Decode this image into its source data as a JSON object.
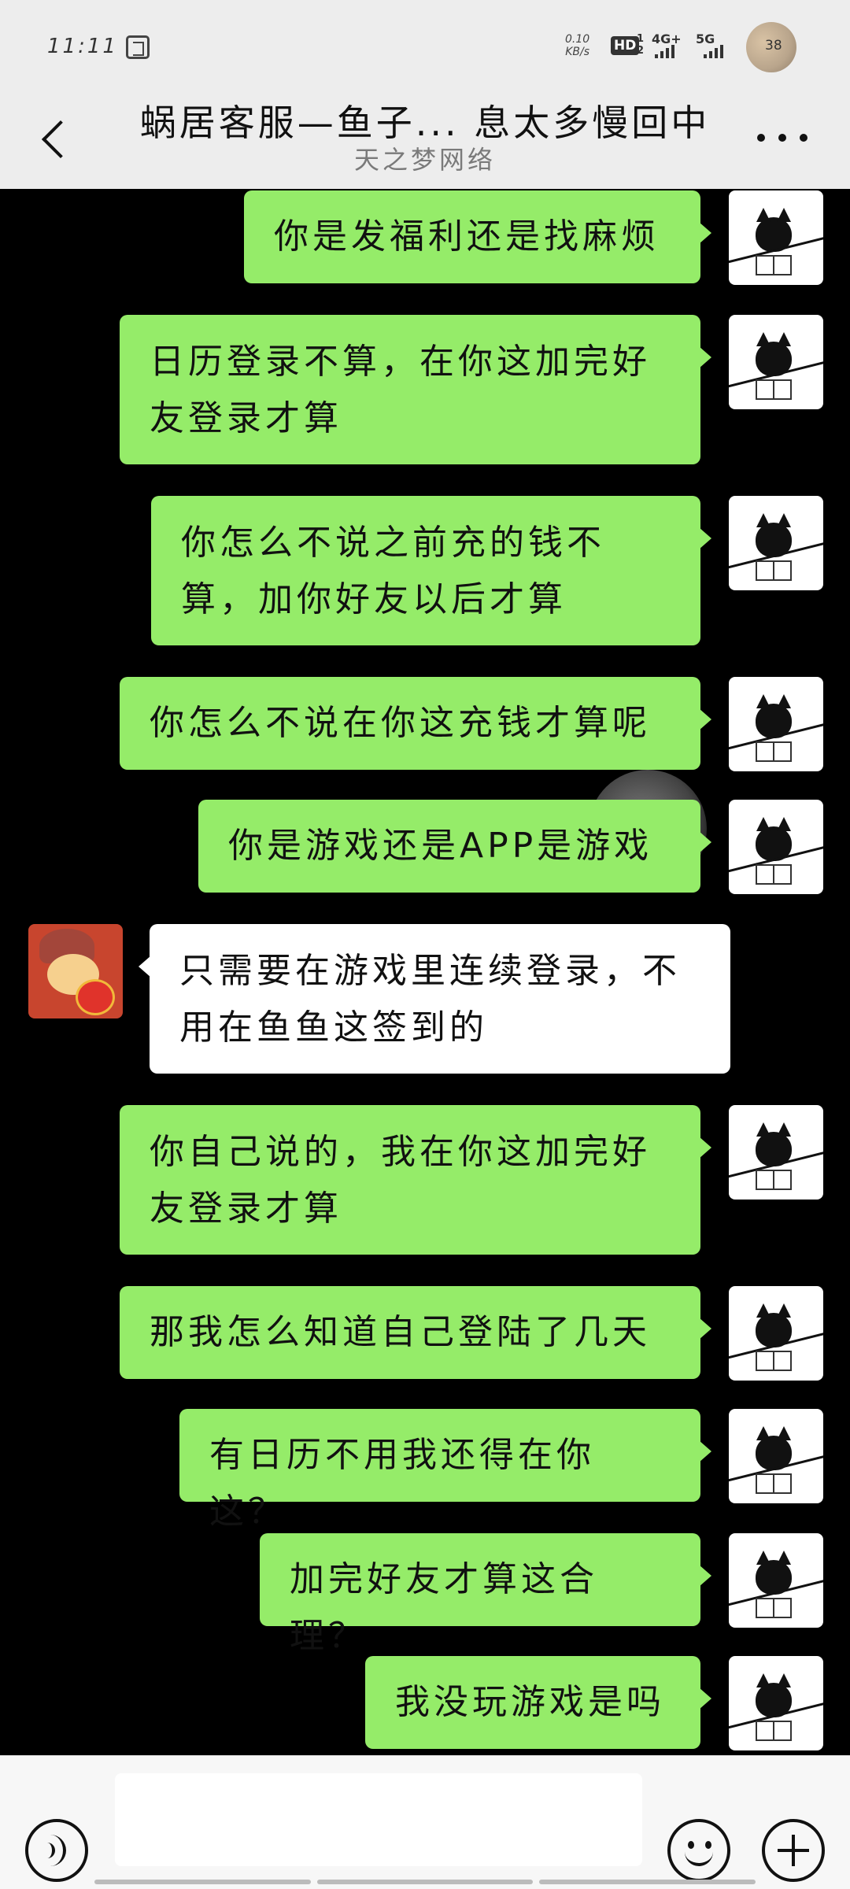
{
  "status_bar": {
    "time": "11:11",
    "net_speed_value": "0.10",
    "net_speed_unit": "KB/s",
    "hd_label": "HD",
    "hd_sub_top": "1",
    "hd_sub_bottom": "2",
    "network_1": "4G+",
    "network_2": "5G",
    "badge_count": "38"
  },
  "header": {
    "title": "蜗居客服—鱼子... 息太多慢回中",
    "subtitle": "天之梦网络"
  },
  "messages": [
    {
      "sender": "me",
      "text": "你是发福利还是找麻烦"
    },
    {
      "sender": "me",
      "text": "日历登录不算，在你这加完好友登录才算"
    },
    {
      "sender": "me",
      "text": "你怎么不说之前充的钱不算，加你好友以后才算"
    },
    {
      "sender": "me",
      "text": "你怎么不说在你这充钱才算呢"
    },
    {
      "sender": "me",
      "text": "你是游戏还是APP是游戏"
    },
    {
      "sender": "other",
      "text": "只需要在游戏里连续登录，不用在鱼鱼这签到的"
    },
    {
      "sender": "me",
      "text": "你自己说的，我在你这加完好友登录才算"
    },
    {
      "sender": "me",
      "text": "那我怎么知道自己登陆了几天"
    },
    {
      "sender": "me",
      "text": "有日历不用我还得在你这？"
    },
    {
      "sender": "me",
      "text": "加完好友才算这合理？"
    },
    {
      "sender": "me",
      "text": "我没玩游戏是吗"
    }
  ],
  "input_bar": {
    "placeholder": ""
  }
}
